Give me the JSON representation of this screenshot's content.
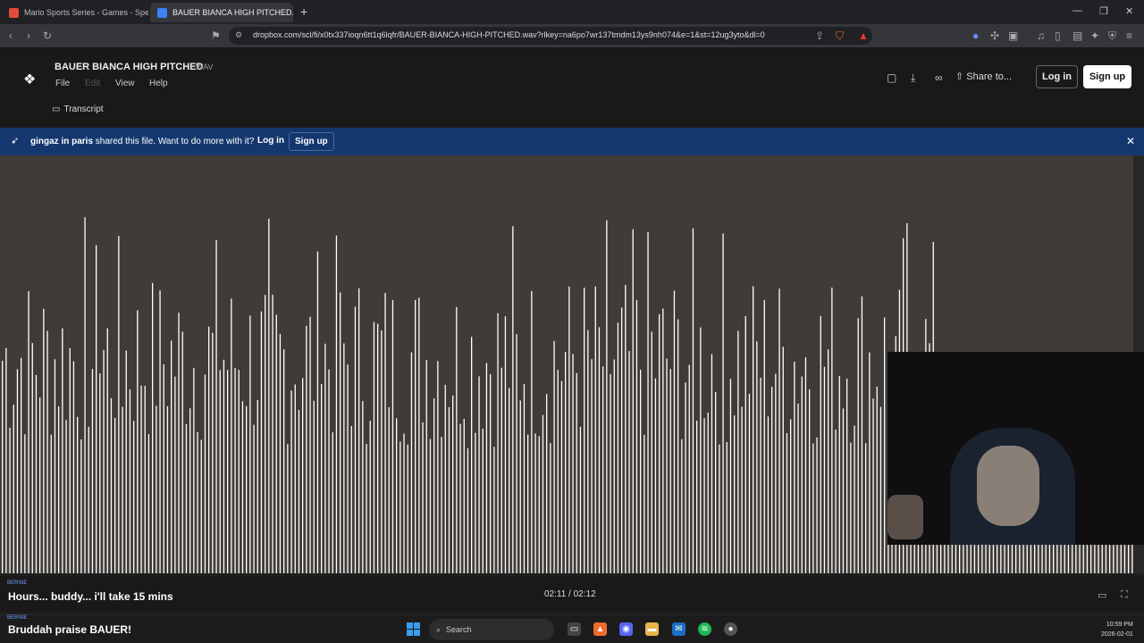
{
  "browser": {
    "tabs": [
      {
        "label": "Mario Sports Series - Games - Speed",
        "favicon_color": "#e24b3a"
      },
      {
        "label": "BAUER BIANCA HIGH PITCHED.w",
        "favicon_color": "#3b82f6"
      }
    ],
    "new_tab_label": "+",
    "url": "dropbox.com/scl/fi/x0tx337ioqn6tt1q6lqfr/BAUER-BIANCA-HIGH-PITCHED.wav?rlkey=na6po7wr137tmdm13ys9nh074&e=1&st=12ug3yto&dl=0"
  },
  "app": {
    "file_title": "BAUER BIANCA HIGH PITCHED",
    "file_ext": "WAV",
    "menu": [
      "File",
      "Edit",
      "View",
      "Help"
    ],
    "transcript_label": "Transcript",
    "share_label": "Share to...",
    "login_label": "Log in",
    "signup_label": "Sign up"
  },
  "banner": {
    "sharer": "gingaz in paris",
    "message": "shared this file. Want to do more with it?",
    "login_label": "Log in",
    "signup_label": "Sign up"
  },
  "player": {
    "time": "02:11 / 02:12",
    "progress": 0.992
  },
  "chat": [
    {
      "user": "BERNIE",
      "message": "Hours... buddy... i'll take 15 mins"
    },
    {
      "user": "BERNIE",
      "message": "Bruddah praise BAUER!"
    }
  ],
  "taskbar": {
    "search_label": "Search",
    "time": "10:59 PM",
    "date": "2026-02-01"
  },
  "colors": {
    "banner": "#14386e",
    "waveform_bg": "#3f3b37",
    "waveform_bar": "#ffffff"
  }
}
